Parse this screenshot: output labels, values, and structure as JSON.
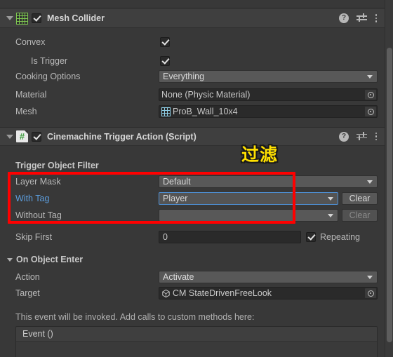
{
  "components": [
    {
      "id": "mesh-collider",
      "title": "Mesh Collider",
      "icon": "mesh-collider-grid-icon",
      "enabled_checkbox": true,
      "foldout_expanded": true,
      "header_icons": {
        "help": "?",
        "preset": "preset-slider-icon",
        "menu": "three-dot-menu-icon"
      },
      "properties": [
        {
          "label": "Convex",
          "type": "checkbox",
          "value": true
        },
        {
          "label": "Is Trigger",
          "type": "checkbox",
          "value": true,
          "indent": true
        },
        {
          "label": "Cooking Options",
          "type": "dropdown",
          "value": "Everything"
        },
        {
          "label": "Material",
          "type": "object",
          "value": "None (Physic Material)",
          "icon": ""
        },
        {
          "label": "Mesh",
          "type": "object",
          "value": "ProB_Wall_10x4",
          "icon": "mesh-grid-icon"
        }
      ]
    },
    {
      "id": "cinemachine-trigger-action",
      "title": "Cinemachine Trigger Action (Script)",
      "icon": "csharp-script-icon",
      "enabled_checkbox": true,
      "foldout_expanded": true,
      "header_icons": {
        "help": "?",
        "preset": "preset-slider-icon",
        "menu": "three-dot-menu-icon"
      },
      "section_filter_label": "Trigger Object Filter",
      "properties": [
        {
          "label": "Layer Mask",
          "type": "dropdown",
          "value": "Default",
          "label_color": "normal"
        },
        {
          "label": "With Tag",
          "type": "dropdown",
          "value": "Player",
          "label_color": "blue",
          "focused": true,
          "clear_label": "Clear",
          "clear_enabled": true
        },
        {
          "label": "Without Tag",
          "type": "dropdown",
          "value": "",
          "label_color": "normal",
          "clear_label": "Clear",
          "clear_enabled": false
        },
        {
          "label": "Skip First",
          "type": "number",
          "value": "0",
          "toggle_label": "Repeating",
          "toggle_value": true
        }
      ],
      "event_section": {
        "title": "On Object Enter",
        "foldout_expanded": true,
        "action": {
          "label": "Action",
          "value": "Activate"
        },
        "target": {
          "label": "Target",
          "value": "CM StateDrivenFreeLook",
          "icon": "gameobject-cube-icon"
        },
        "help_text": "This event will be invoked.  Add calls to custom methods here:",
        "event_list_header": "Event ()"
      }
    }
  ],
  "annotation": {
    "text": "过滤",
    "box_color": "#ff0000",
    "text_color": "#ffe000"
  },
  "scrollbar": {
    "orientation": "vertical",
    "thumb_color": "#5d5d5d"
  }
}
